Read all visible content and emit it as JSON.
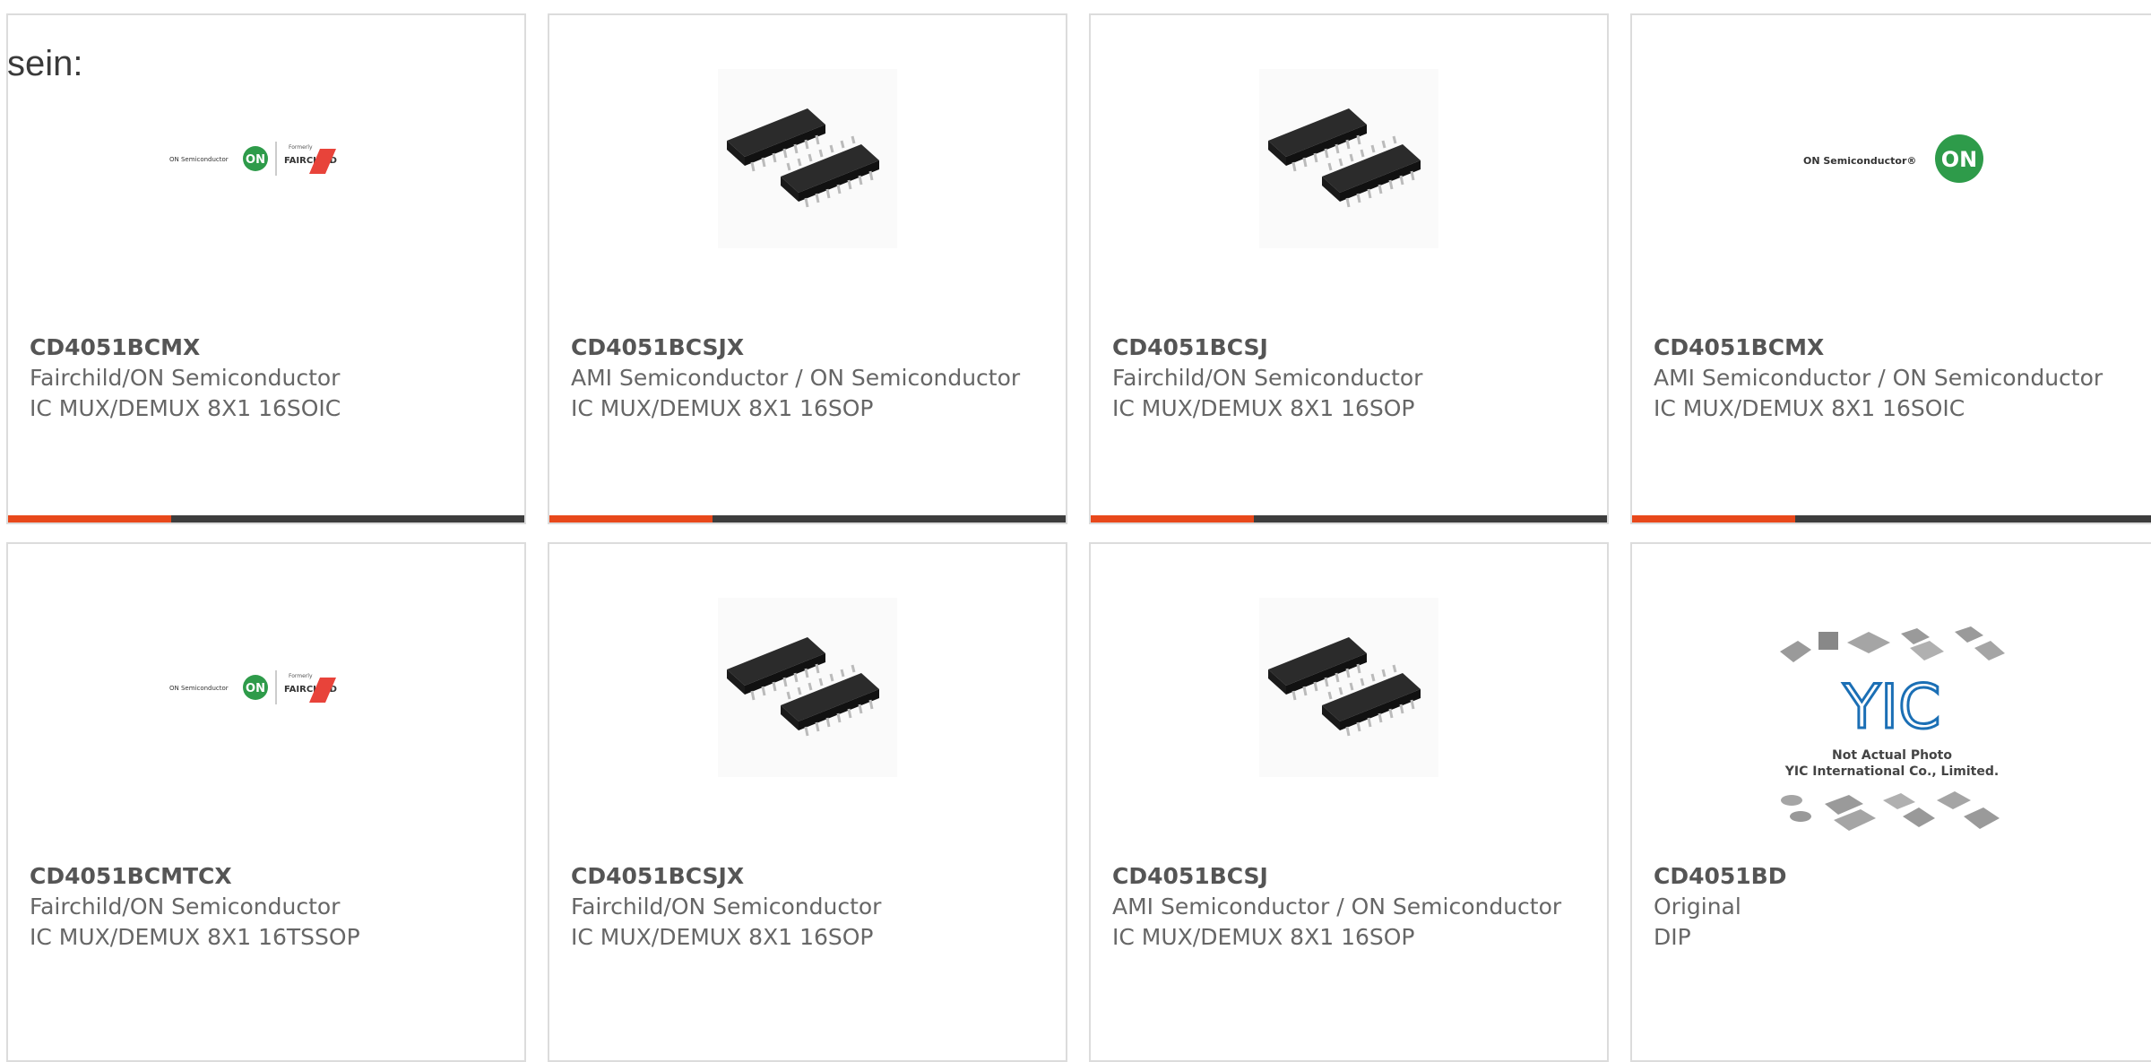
{
  "heading": "sein:",
  "colors": {
    "accent": "#e8481b",
    "bar": "#3d3d3d",
    "border": "#dcdcdc",
    "text": "#666666"
  },
  "products": [
    {
      "part": "CD4051BCMX",
      "manufacturer": "Fairchild/ON Semiconductor",
      "description": "IC MUX/DEMUX 8X1 16SOIC",
      "image": "fairchild-on-logo"
    },
    {
      "part": "CD4051BCSJX",
      "manufacturer": "AMI Semiconductor / ON Semiconductor",
      "description": "IC MUX/DEMUX 8X1 16SOP",
      "image": "chip-photo"
    },
    {
      "part": "CD4051BCSJ",
      "manufacturer": "Fairchild/ON Semiconductor",
      "description": "IC MUX/DEMUX 8X1 16SOP",
      "image": "chip-photo"
    },
    {
      "part": "CD4051BCMX",
      "manufacturer": "AMI Semiconductor / ON Semiconductor",
      "description": "IC MUX/DEMUX 8X1 16SOIC",
      "image": "on-semi-logo"
    },
    {
      "part": "CD4051BCMTCX",
      "manufacturer": "Fairchild/ON Semiconductor",
      "description": "IC MUX/DEMUX 8X1 16TSSOP",
      "image": "fairchild-on-logo"
    },
    {
      "part": "CD4051BCSJX",
      "manufacturer": "Fairchild/ON Semiconductor",
      "description": "IC MUX/DEMUX 8X1 16SOP",
      "image": "chip-photo"
    },
    {
      "part": "CD4051BCSJ",
      "manufacturer": "AMI Semiconductor / ON Semiconductor",
      "description": "IC MUX/DEMUX 8X1 16SOP",
      "image": "chip-photo"
    },
    {
      "part": "CD4051BD",
      "manufacturer": "Original",
      "description": "DIP",
      "image": "yic-placeholder"
    }
  ],
  "logos": {
    "on_semi_small": "ON Semiconductor",
    "on_mark": "ON",
    "formerly": "Formerly",
    "fairchild": "FAIRCHILD",
    "on_semi_large": "ON Semiconductor®",
    "yic_mark": "YIC",
    "yic_line1": "Not Actual Photo",
    "yic_line2": "YIC International Co., Limited."
  }
}
